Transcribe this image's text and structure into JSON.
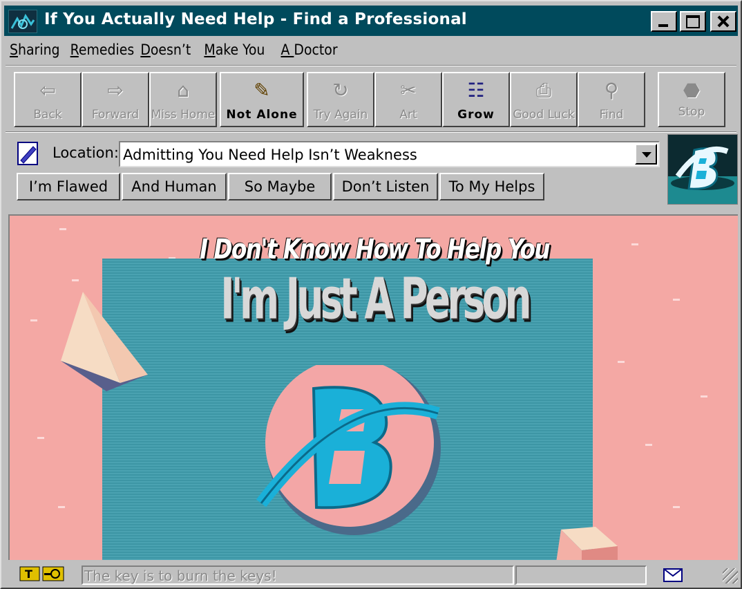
{
  "window": {
    "title": "If You Actually Need Help - Find a Professional",
    "controls": [
      "minimize",
      "maximize",
      "close"
    ]
  },
  "menu": [
    {
      "label": "Sharing",
      "accel": "S",
      "rest": "haring"
    },
    {
      "label": "Remedies",
      "accel": "R",
      "rest": "emedies"
    },
    {
      "label": "Doesn't",
      "accel": "D",
      "rest": "oesn’t"
    },
    {
      "label": "Make You",
      "accel": "M",
      "rest": "ake You"
    },
    {
      "label": "A Doctor",
      "accel": "A ",
      "rest": "Doctor"
    }
  ],
  "toolbar": [
    {
      "label": "Back",
      "icon": "arrow-left-icon",
      "glyph": "⇦",
      "enabled": false
    },
    {
      "label": "Forward",
      "icon": "arrow-right-icon",
      "glyph": "⇨",
      "enabled": false
    },
    {
      "label": "Miss Home",
      "icon": "home-icon",
      "glyph": "⌂",
      "enabled": false
    },
    {
      "label": "Not Alone",
      "icon": "pencil-icon",
      "glyph": "✎",
      "enabled": true
    },
    {
      "label": "Try Again",
      "icon": "refresh-icon",
      "glyph": "↻",
      "enabled": false
    },
    {
      "label": "Art",
      "icon": "art-icon",
      "glyph": "✂",
      "enabled": false
    },
    {
      "label": "Grow",
      "icon": "grow-icon",
      "glyph": "☷",
      "enabled": true
    },
    {
      "label": "Good Luck",
      "icon": "printer-icon",
      "glyph": "⎙",
      "enabled": false
    },
    {
      "label": "Find",
      "icon": "binoculars-icon",
      "glyph": "⚲",
      "enabled": false
    },
    {
      "label": "Stop",
      "icon": "stop-icon",
      "glyph": "⬣",
      "enabled": false
    }
  ],
  "location": {
    "label": "Location:",
    "value": "Admitting You Need Help Isn’t Weakness"
  },
  "links": [
    "I’m Flawed",
    "And Human",
    "So Maybe",
    "Don’t Listen",
    "To My Helps"
  ],
  "content": {
    "headline": "I Don't Know How To Help You",
    "subheadline": "I'm Just A Person",
    "colors": {
      "background": "#f4a8a4",
      "panel": "#3f9cac",
      "logo": "#1ab0d8"
    }
  },
  "status": {
    "text": "The key is to burn the keys!"
  }
}
